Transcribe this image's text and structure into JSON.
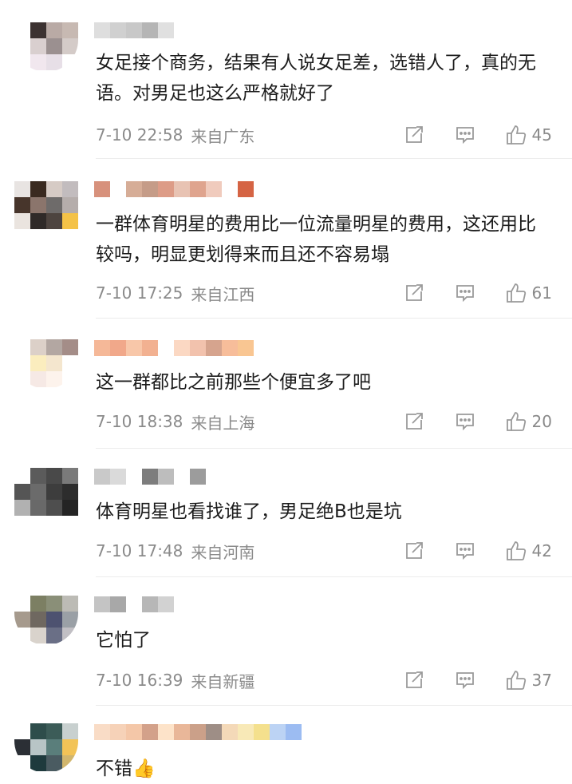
{
  "comments": [
    {
      "text": "女足接个商务，结果有人说女足差，选错人了，真的无语。对男足也这么严格就好了",
      "time": "7-10 22:58",
      "location": "来自广东",
      "likes": "45",
      "avatar_colors": [
        "#ffffff",
        "#3c3231",
        "#b9aaa5",
        "#c7b9b2",
        "#ffffff",
        "#d9cfcf",
        "#9b9090",
        "#d4cbc8",
        "#ffffff",
        "#f1e7ee",
        "#e7dfe7",
        "#ffffff"
      ],
      "name_colors": [
        "#dedede",
        "#d0d0d0",
        "#c8c8c8",
        "#b5b5b5",
        "#e0e0e0"
      ]
    },
    {
      "text": "一群体育明星的费用比一位流量明星的费用，这还用比较吗，明显更划得来而且还不容易塌",
      "time": "7-10 17:25",
      "location": "来自江西",
      "likes": "61",
      "avatar_colors": [
        "#e8e4e2",
        "#3a2a20",
        "#d6cbc5",
        "#c2bcbe",
        "#47352b",
        "#8b756c",
        "#6e6b6a",
        "#b5adab",
        "#eae4df",
        "#2f2a28",
        "#4d443f",
        "#f4c247"
      ],
      "name_colors": [
        "#d7917c",
        "#ffffff",
        "#d6ad97",
        "#c59c88",
        "#dd9c87",
        "#e8c3b3",
        "#dfa48e",
        "#f0cbbd",
        "#ffffff",
        "#d56444"
      ]
    },
    {
      "text": "这一群都比之前那些个便宜多了吧",
      "time": "7-10 18:38",
      "location": "来自上海",
      "likes": "20",
      "avatar_colors": [
        "#ffffff",
        "#dcd0c8",
        "#b3a7a2",
        "#a48d88",
        "#ffffff",
        "#fbedbe",
        "#f4e6ce",
        "#ffffff",
        "#ffffff",
        "#f6e9e5",
        "#fdf3ec",
        "#ffffff"
      ],
      "name_colors": [
        "#f5b898",
        "#f1a88a",
        "#f8c7a9",
        "#f2b191",
        "#ffffff",
        "#fbd8c3",
        "#f2c2ad",
        "#d6a48e",
        "#f7bd9a",
        "#f9c692"
      ]
    },
    {
      "text": "体育明星也看找谁了，男足绝B也是坑",
      "time": "7-10 17:48",
      "location": "来自河南",
      "likes": "42",
      "avatar_colors": [
        "#ffffff",
        "#5b5b5b",
        "#494949",
        "#7a7a7a",
        "#555555",
        "#6b6b6b",
        "#3d3d3d",
        "#2d2d2d",
        "#b1b1b1",
        "#696969",
        "#4e4e4e",
        "#242424"
      ],
      "name_colors": [
        "#c9c9c9",
        "#dadada",
        "#ffffff",
        "#7d7d7d",
        "#bdbdbd",
        "#ffffff",
        "#9c9c9c"
      ]
    },
    {
      "text": "它怕了",
      "time": "7-10 16:39",
      "location": "来自新疆",
      "likes": "37",
      "avatar_colors": [
        "#ffffff",
        "#7c7f63",
        "#8a8f78",
        "#bcbbb5",
        "#a69a8d",
        "#6f6860",
        "#4d5270",
        "#9aa0a6",
        "#ffffff",
        "#d9d3cc",
        "#6a6f86",
        "#c1bfc4"
      ],
      "name_colors": [
        "#c4c4c4",
        "#a8a8a8",
        "#ffffff",
        "#b7b7b7",
        "#d2d2d2"
      ]
    },
    {
      "text": "不错👍",
      "avatar_colors": [
        "#ffffff",
        "#2e4d4b",
        "#3c5c58",
        "#c8d0cf",
        "#2b2f35",
        "#b8c5c6",
        "#5a7e7b",
        "#f2c357",
        "#ffffff",
        "#1e3a3d",
        "#4a5b61",
        "#d1b66d"
      ],
      "name_colors": [
        "#f9dcc6",
        "#f6d2b8",
        "#f4c7a8",
        "#d3a18a",
        "#fde3c9",
        "#e9b799",
        "#cba089",
        "#9e8e86",
        "#f4d9b8",
        "#f8e9b7",
        "#f4e08d",
        "#bcd3f4",
        "#9cbcf2"
      ]
    }
  ]
}
